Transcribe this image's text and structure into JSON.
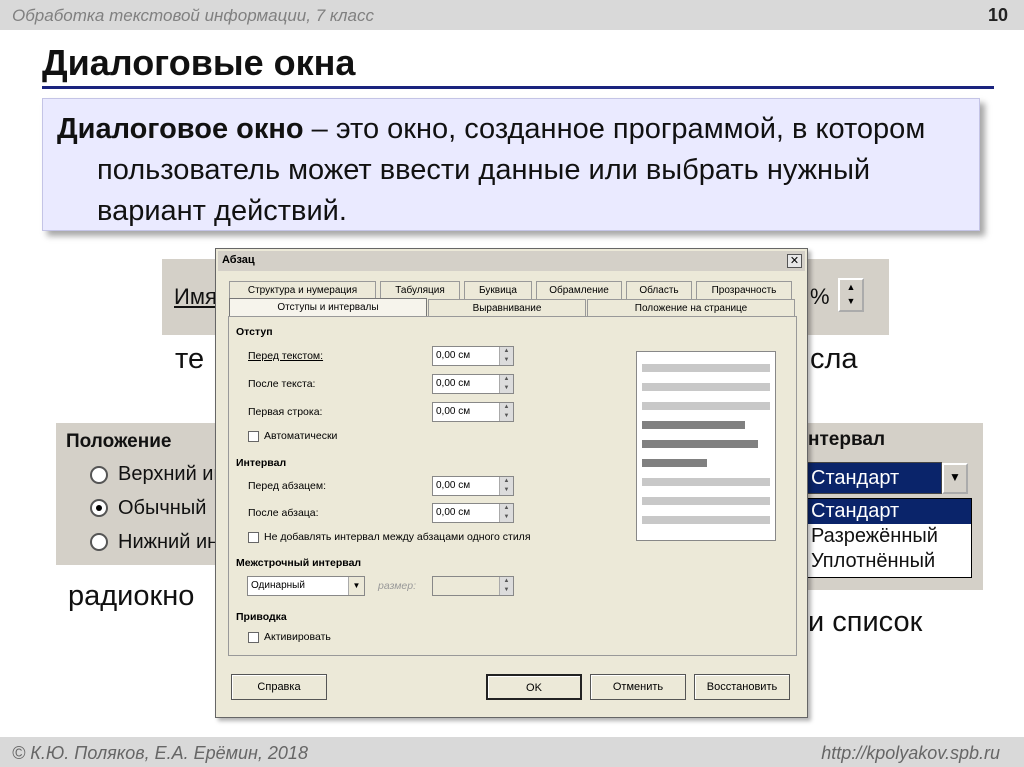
{
  "slide": {
    "course": "Обработка текстовой информации, 7 класс",
    "page_number": "10",
    "title": "Диалоговые окна",
    "definition_term": "Диалоговое окно",
    "definition_text": " – это окно, созданное программой, в котором пользователь может ввести данные или выбрать нужный вариант действий.",
    "footer_left": "© К.Ю. Поляков, Е.А. Ерёмин, 2018",
    "footer_right": "http://kpolyakov.spb.ru"
  },
  "background": {
    "name_label": "Имя",
    "percent": "%",
    "text_frag_left": "те",
    "text_frag_right": "сла",
    "position_title": "Положение",
    "radio_top": "Верхний ин",
    "radio_normal": "Обычный",
    "radio_bottom": "Нижний ин",
    "interval_label": "нтервал",
    "combo_value": "Стандарт",
    "list_items": [
      "Стандарт",
      "Разрежённый",
      "Уплотнённый"
    ],
    "radio_caption": "радиокно",
    "list_caption": "и список"
  },
  "dialog": {
    "title": "Абзац",
    "close": "✕",
    "tabs_top": [
      "Структура и нумерация",
      "Табуляция",
      "Буквица",
      "Обрамление",
      "Область",
      "Прозрачность"
    ],
    "tabs_bottom": [
      "Отступы и интервалы",
      "Выравнивание",
      "Положение на странице"
    ],
    "indent": {
      "header": "Отступ",
      "before_label": "Перед текстом:",
      "before_value": "0,00 см",
      "after_label": "После текста:",
      "after_value": "0,00 см",
      "first_label": "Первая строка:",
      "first_value": "0,00 см",
      "auto_label": "Автоматически"
    },
    "spacing": {
      "header": "Интервал",
      "above_label": "Перед абзацем:",
      "above_value": "0,00 см",
      "below_label": "После абзаца:",
      "below_value": "0,00 см",
      "no_space_label": "Не добавлять интервал между абзацами одного стиля"
    },
    "line_spacing": {
      "header": "Межстрочный интервал",
      "value": "Одинарный",
      "size_label": "размер:"
    },
    "snap": {
      "header": "Приводка",
      "activate_label": "Активировать"
    },
    "buttons": {
      "help": "Справка",
      "ok": "OK",
      "cancel": "Отменить",
      "reset": "Восстановить"
    }
  }
}
